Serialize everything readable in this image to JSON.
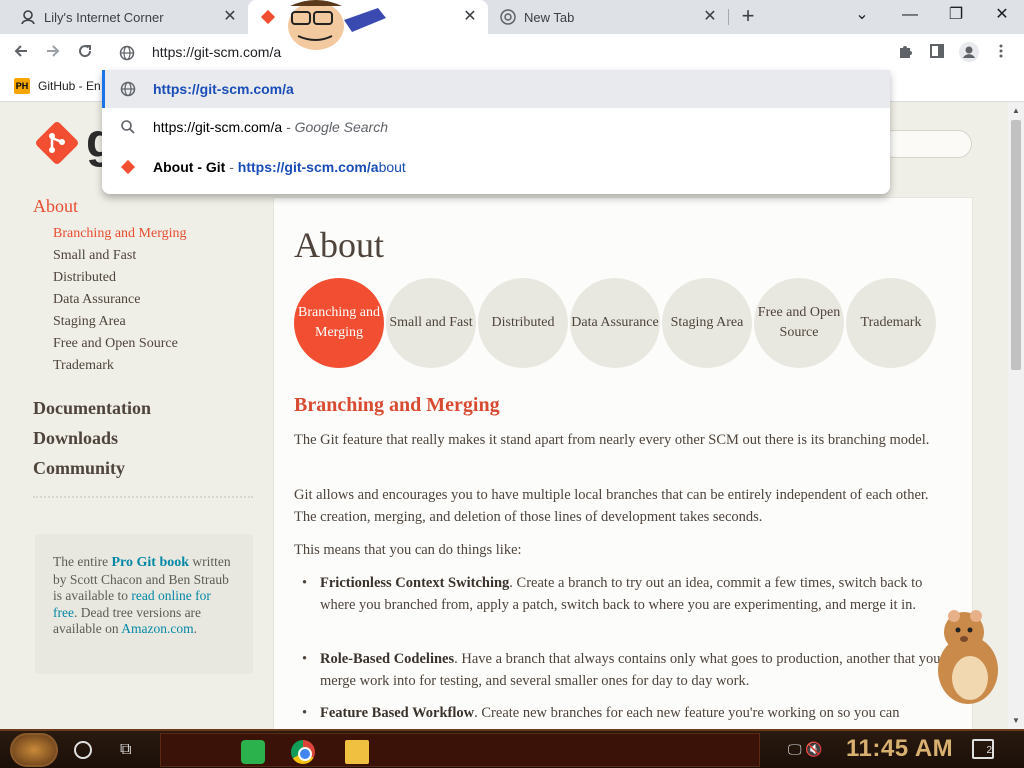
{
  "tabs": [
    {
      "title": "Lily's Internet Corner",
      "close": "✕"
    },
    {
      "title": "",
      "close": "✕"
    },
    {
      "title": "New Tab",
      "close": "✕"
    }
  ],
  "new_tab_label": "+",
  "window_controls": {
    "menu": "⌄",
    "minimize": "—",
    "restore": "❐",
    "close": "✕"
  },
  "omnibox": {
    "value": "https://git-scm.com/a"
  },
  "bookmarks": [
    {
      "icon_text": "PH",
      "label": "GitHub - En"
    }
  ],
  "suggestions": [
    {
      "icon": "globe-icon",
      "text": "https://git-scm.com/a"
    },
    {
      "icon": "search-icon",
      "text": "https://git-scm.com/a",
      "suffix": " - Google Search"
    },
    {
      "icon": "git-icon",
      "title": "About - Git",
      "sep": " - ",
      "url_bold": "https://git-scm.com/a",
      "url_rest": "bout"
    }
  ],
  "site": {
    "logo_text": "git",
    "sidebar": {
      "about": "About",
      "sub": [
        "Branching and Merging",
        "Small and Fast",
        "Distributed",
        "Data Assurance",
        "Staging Area",
        "Free and Open Source",
        "Trademark"
      ],
      "main": [
        "Documentation",
        "Downloads",
        "Community"
      ]
    },
    "book": {
      "p1": "The entire ",
      "link1": "Pro Git book",
      "p2": " written by Scott Chacon and Ben Straub is available to ",
      "link2": "read online for free",
      "p3": ". Dead tree versions are available on ",
      "link3": "Amazon.com",
      "p4": "."
    },
    "title": "About",
    "circles": [
      "Branching and Merging",
      "Small and Fast",
      "Distributed",
      "Data Assurance",
      "Staging Area",
      "Free and Open Source",
      "Trademark"
    ],
    "section_title": "Branching and Merging",
    "p1": "The Git feature that really makes it stand apart from nearly every other SCM out there is its branching model.",
    "p2": "Git allows and encourages you to have multiple local branches that can be entirely independent of each other. The creation, merging, and deletion of those lines of development takes seconds.",
    "p3": "This means that you can do things like:",
    "bullets": [
      {
        "title": "Frictionless Context Switching",
        "text": ". Create a branch to try out an idea, commit a few times, switch back to where you branched from, apply a patch, switch back to where you are experimenting, and merge it in."
      },
      {
        "title": "Role-Based Codelines",
        "text": ". Have a branch that always contains only what goes to production, another that you merge work into for testing, and several smaller ones for day to day work."
      },
      {
        "title": "Feature Based Workflow",
        "text": ". Create new branches for each new feature you're working on so you can"
      }
    ]
  },
  "taskbar": {
    "clock": "11:45 AM",
    "notification_count": "2"
  },
  "colors": {
    "accent": "#f14e32",
    "link": "#0388a6",
    "highlight": "#e8eaed"
  }
}
